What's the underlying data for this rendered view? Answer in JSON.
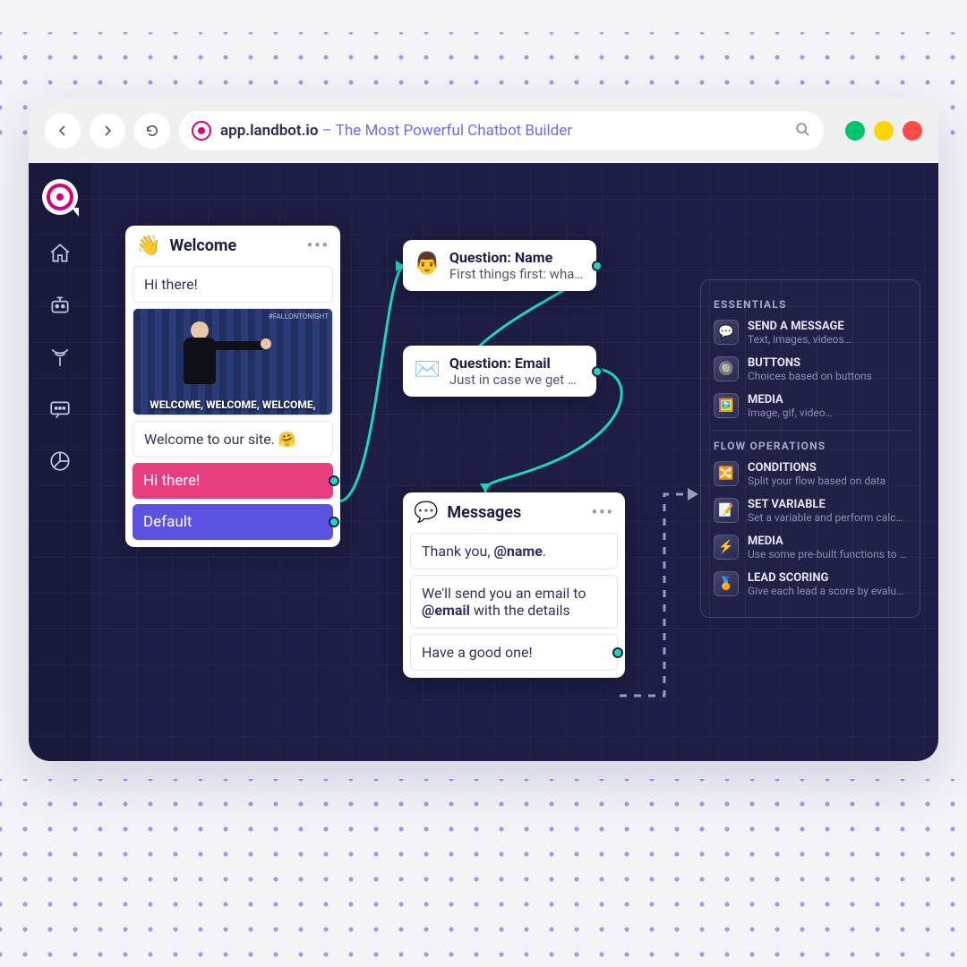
{
  "browser": {
    "url_domain": "app.landbot.io",
    "url_tagline": " – The Most Powerful Chatbot Builder"
  },
  "sidebar": {
    "items": [
      "home",
      "bot",
      "broadcast",
      "chat",
      "analytics"
    ]
  },
  "welcome": {
    "title": "Welcome",
    "icon": "👋",
    "greeting": "Hi there!",
    "gif_caption": "WELCOME, WELCOME, WELCOME,",
    "gif_tag": "#FALLONTONIGHT",
    "welcome_text": "Welcome to our site. 🤗",
    "pill_pink": "Hi there!",
    "pill_blue": "Default"
  },
  "qname": {
    "icon": "👨",
    "title": "Question: Name",
    "sub": "First things first: wha…"
  },
  "qemail": {
    "icon": "✉️",
    "title": "Question: Email",
    "sub": "Just in case we get d…"
  },
  "messages": {
    "icon": "💬",
    "title": "Messages",
    "row1_pre": "Thank you, ",
    "row1_var": "@name",
    "row1_post": ".",
    "row2_pre": "We'll send you an email to ",
    "row2_var": "@email",
    "row2_post": " with the details",
    "row3": "Have a good one!"
  },
  "palette": {
    "section1": "ESSENTIALS",
    "section2": "FLOW OPERATIONS",
    "items1": [
      {
        "icon": "💬",
        "name": "SEND A MESSAGE",
        "desc": "Text, images, videos…"
      },
      {
        "icon": "🔘",
        "name": "BUTTONS",
        "desc": "Choices based on buttons"
      },
      {
        "icon": "🖼️",
        "name": "MEDIA",
        "desc": "Image, gif, video…"
      }
    ],
    "items2": [
      {
        "icon": "🔀",
        "name": "CONDITIONS",
        "desc": "Split your flow based on data"
      },
      {
        "icon": "📝",
        "name": "SET VARIABLE",
        "desc": "Set a variable and perform calcul…"
      },
      {
        "icon": "⚡",
        "name": "MEDIA",
        "desc": "Use some pre-built functions to …"
      },
      {
        "icon": "🏅",
        "name": "LEAD SCORING",
        "desc": "Give each lead a score by evalua…"
      }
    ]
  }
}
